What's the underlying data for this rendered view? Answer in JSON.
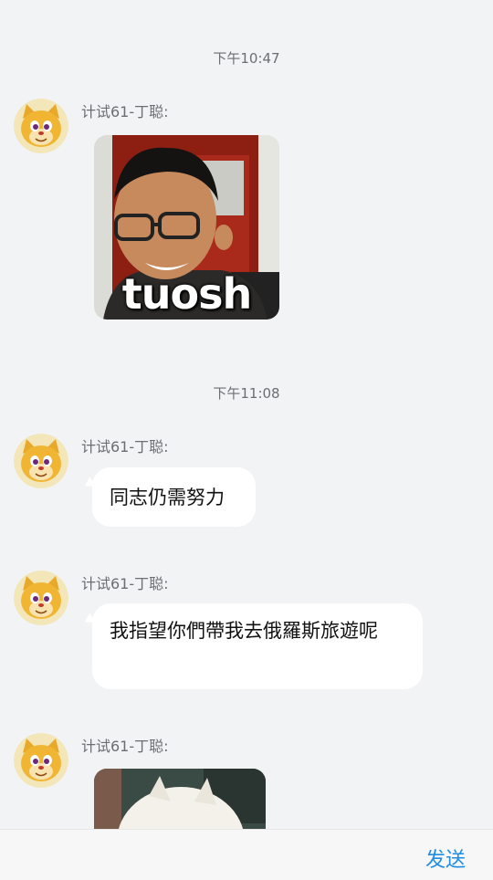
{
  "messages": [
    {
      "timestamp": "下午10:47",
      "sender": "计试61-丁聪:",
      "type": "sticker",
      "caption": "tuosh"
    },
    {
      "timestamp": "下午11:08",
      "sender": "计试61-丁聪:",
      "type": "text",
      "text": "同志仍需努力"
    },
    {
      "sender": "计试61-丁聪:",
      "type": "text",
      "text": "我指望你們帶我去俄羅斯旅遊呢"
    },
    {
      "sender": "计试61-丁聪:",
      "type": "sticker"
    }
  ],
  "bottom_bar": {
    "send_label": "发送"
  },
  "colors": {
    "background": "#f2f3f5",
    "bubble": "#ffffff",
    "accent": "#1f8de1"
  },
  "icons": {
    "avatar": "cartoon-cat-avatar-icon"
  }
}
